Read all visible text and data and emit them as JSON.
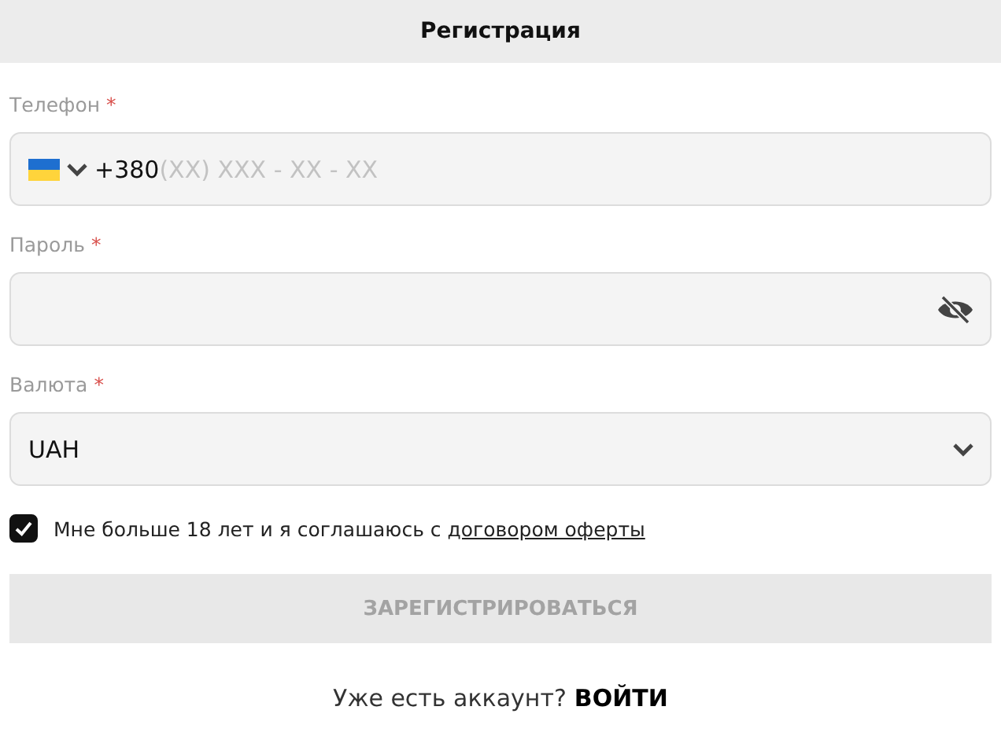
{
  "header": {
    "title": "Регистрация"
  },
  "phone": {
    "label": "Телефон",
    "required_mark": "*",
    "value": "+380",
    "placeholder": "(XX) XXX - XX - XX"
  },
  "password": {
    "label": "Пароль",
    "required_mark": "*"
  },
  "currency": {
    "label": "Валюта",
    "required_mark": "*",
    "value": "UAH"
  },
  "consent": {
    "checked": true,
    "text": "Мне больше 18 лет и я соглашаюсь с",
    "link": "договором оферты"
  },
  "submit": {
    "label": "ЗАРЕГИСТРИРОВАТЬСЯ",
    "disabled": true
  },
  "footer": {
    "text": "Уже есть аккаунт?",
    "link": "ВОЙТИ"
  }
}
